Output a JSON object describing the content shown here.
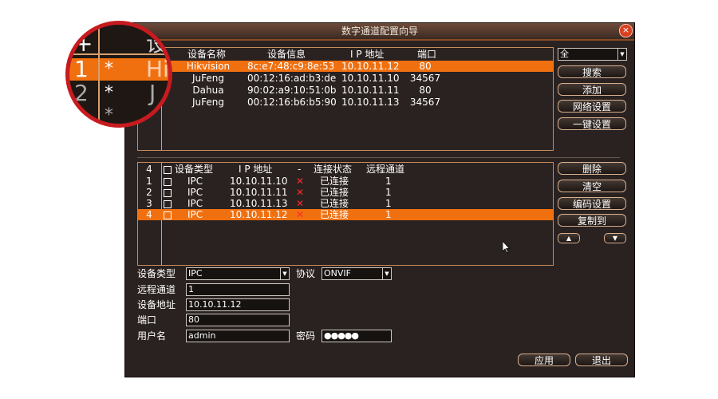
{
  "window": {
    "title": "数字通道配置向导",
    "close_label": "×"
  },
  "search_list": {
    "headers": {
      "name": "设备名称",
      "info": "设备信息",
      "ip": "I P 地址",
      "port": "端口"
    },
    "rows": [
      {
        "name": "Hikvision",
        "info": "8c:e7:48:c9:8e:53",
        "ip": "10.10.11.12",
        "port": "80",
        "selected": true
      },
      {
        "name": "JuFeng",
        "info": "00:12:16:ad:b3:de",
        "ip": "10.10.11.10",
        "port": "34567",
        "selected": false
      },
      {
        "name": "Dahua",
        "info": "90:02:a9:10:51:0b",
        "ip": "10.10.11.11",
        "port": "80",
        "selected": false
      },
      {
        "name": "JuFeng",
        "info": "00:12:16:b6:b5:90",
        "ip": "10.10.11.13",
        "port": "34567",
        "selected": false
      }
    ]
  },
  "filter": {
    "value": "全"
  },
  "right_buttons_top": {
    "search": "搜索",
    "add": "添加",
    "network": "网络设置",
    "oneclick": "一键设置"
  },
  "channel_list": {
    "headers": {
      "count": "4",
      "type": "设备类型",
      "ip": "I P 地址",
      "dash": "-",
      "status": "连接状态",
      "remote": "远程通道"
    },
    "rows": [
      {
        "no": "1",
        "type": "IPC",
        "ip": "10.10.11.10",
        "x": "✕",
        "status": "已连接",
        "remote": "1",
        "selected": false
      },
      {
        "no": "2",
        "type": "IPC",
        "ip": "10.10.11.11",
        "x": "✕",
        "status": "已连接",
        "remote": "1",
        "selected": false
      },
      {
        "no": "3",
        "type": "IPC",
        "ip": "10.10.11.13",
        "x": "✕",
        "status": "已连接",
        "remote": "1",
        "selected": false
      },
      {
        "no": "4",
        "type": "IPC",
        "ip": "10.10.11.12",
        "x": "✕",
        "status": "已连接",
        "remote": "1",
        "selected": true
      }
    ]
  },
  "right_buttons_bottom": {
    "delete": "删除",
    "clear": "清空",
    "encode": "编码设置",
    "copy": "复制到"
  },
  "form": {
    "device_type_label": "设备类型",
    "device_type": "IPC",
    "protocol_label": "协议",
    "protocol": "ONVIF",
    "remote_channel_label": "远程通道",
    "remote_channel": "1",
    "address_label": "设备地址",
    "address": "10.10.11.12",
    "port_label": "端口",
    "port": "80",
    "username_label": "用户名",
    "username": "admin",
    "password_label": "密码",
    "password": "●●●●●"
  },
  "footer": {
    "apply": "应用",
    "exit": "退出"
  },
  "magnifier": {
    "rows": [
      {
        "no": "+",
        "star": "",
        "text": "设"
      },
      {
        "no": "1",
        "star": "*",
        "text": "Hi"
      },
      {
        "no": "2",
        "star": "*",
        "text": "J"
      },
      {
        "no": "",
        "star": "*",
        "text": ""
      }
    ]
  },
  "colors": {
    "accent": "#f07010",
    "window_bg": "#2a2220",
    "border": "#c88a5a",
    "magnifier_ring": "#c71b1f"
  }
}
